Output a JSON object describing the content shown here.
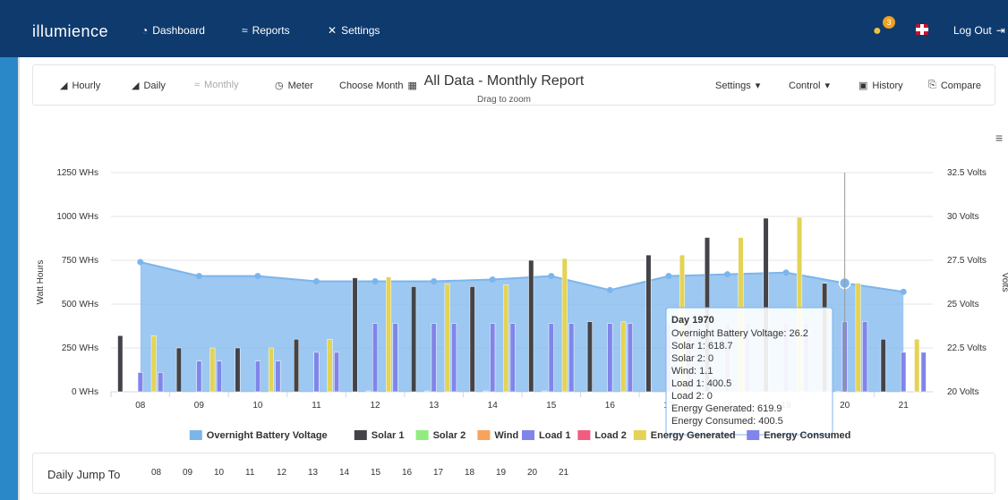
{
  "nav": {
    "brand": "illumience",
    "items": [
      "Dashboard",
      "Reports",
      "Settings"
    ],
    "badge_count": "3",
    "logout": "Log Out"
  },
  "toolbar": {
    "left": [
      "Hourly",
      "Daily",
      "Monthly",
      "Meter",
      "Choose Month"
    ],
    "right": [
      "Settings",
      "Control",
      "History",
      "Compare"
    ]
  },
  "chart_data": {
    "type": "bar",
    "title": "All Data - Monthly Report",
    "subtitle": "Drag to zoom",
    "ylabel_left": "Watt Hours",
    "ylabel_right": "Volts",
    "categories": [
      "08",
      "09",
      "10",
      "11",
      "12",
      "13",
      "14",
      "15",
      "16",
      "17",
      "18",
      "19",
      "20",
      "21"
    ],
    "ylim_left": [
      0,
      1250
    ],
    "ylim_right": [
      20,
      32.5
    ],
    "left_ticks": [
      "0 WHs",
      "250 WHs",
      "500 WHs",
      "750 WHs",
      "1000 WHs",
      "1250 WHs"
    ],
    "right_ticks": [
      "20 Volts",
      "22.5 Volts",
      "25 Volts",
      "27.5 Volts",
      "30 Volts",
      "32.5 Volts"
    ],
    "series": [
      {
        "name": "Overnight Battery Voltage",
        "color": "#7cb5ec",
        "axis": "right",
        "kind": "area",
        "values": [
          27.4,
          26.6,
          26.6,
          26.3,
          26.3,
          26.3,
          26.4,
          26.6,
          25.8,
          26.6,
          26.7,
          26.8,
          26.2,
          25.7
        ]
      },
      {
        "name": "Solar 1",
        "color": "#434348",
        "values": [
          320,
          250,
          250,
          300,
          650,
          600,
          600,
          750,
          400,
          780,
          880,
          990,
          618.7,
          300
        ]
      },
      {
        "name": "Solar 2",
        "color": "#90ed7d",
        "values": [
          0,
          0,
          0,
          0,
          0,
          0,
          0,
          0,
          0,
          0,
          0,
          0,
          0,
          0
        ]
      },
      {
        "name": "Wind",
        "color": "#f7a35c",
        "values": [
          0,
          0,
          0,
          0,
          5,
          5,
          5,
          5,
          0,
          0,
          0,
          0,
          1.1,
          0
        ]
      },
      {
        "name": "Load 1",
        "color": "#8085e9",
        "values": [
          110,
          175,
          175,
          225,
          390,
          390,
          390,
          390,
          390,
          390,
          390,
          390,
          400.5,
          225
        ]
      },
      {
        "name": "Load 2",
        "color": "#f15c80",
        "values": [
          0,
          0,
          0,
          0,
          0,
          0,
          0,
          0,
          0,
          0,
          0,
          0,
          0,
          0
        ]
      },
      {
        "name": "Energy Generated",
        "color": "#e4d354",
        "values": [
          320,
          250,
          250,
          300,
          655,
          615,
          610,
          760,
          400,
          780,
          880,
          995,
          619.9,
          300
        ]
      },
      {
        "name": "Energy Consumed",
        "color": "#8085e9",
        "values": [
          110,
          175,
          175,
          225,
          390,
          390,
          390,
          390,
          390,
          390,
          390,
          390,
          400.5,
          225
        ]
      }
    ],
    "tooltip": {
      "title": "Day 1970",
      "lines": [
        "Overnight Battery Voltage: 26.2",
        "Solar 1: 618.7",
        "Solar 2: 0",
        "Wind: 1.1",
        "Load 1: 400.5",
        "Load 2: 0",
        "Energy Generated: 619.9",
        "Energy Consumed: 400.5"
      ],
      "category": "20"
    },
    "legend_position": "bottom"
  },
  "jump": {
    "label": "Daily Jump To",
    "days": [
      "08",
      "09",
      "10",
      "11",
      "12",
      "13",
      "14",
      "15",
      "16",
      "17",
      "18",
      "19",
      "20",
      "21"
    ]
  }
}
